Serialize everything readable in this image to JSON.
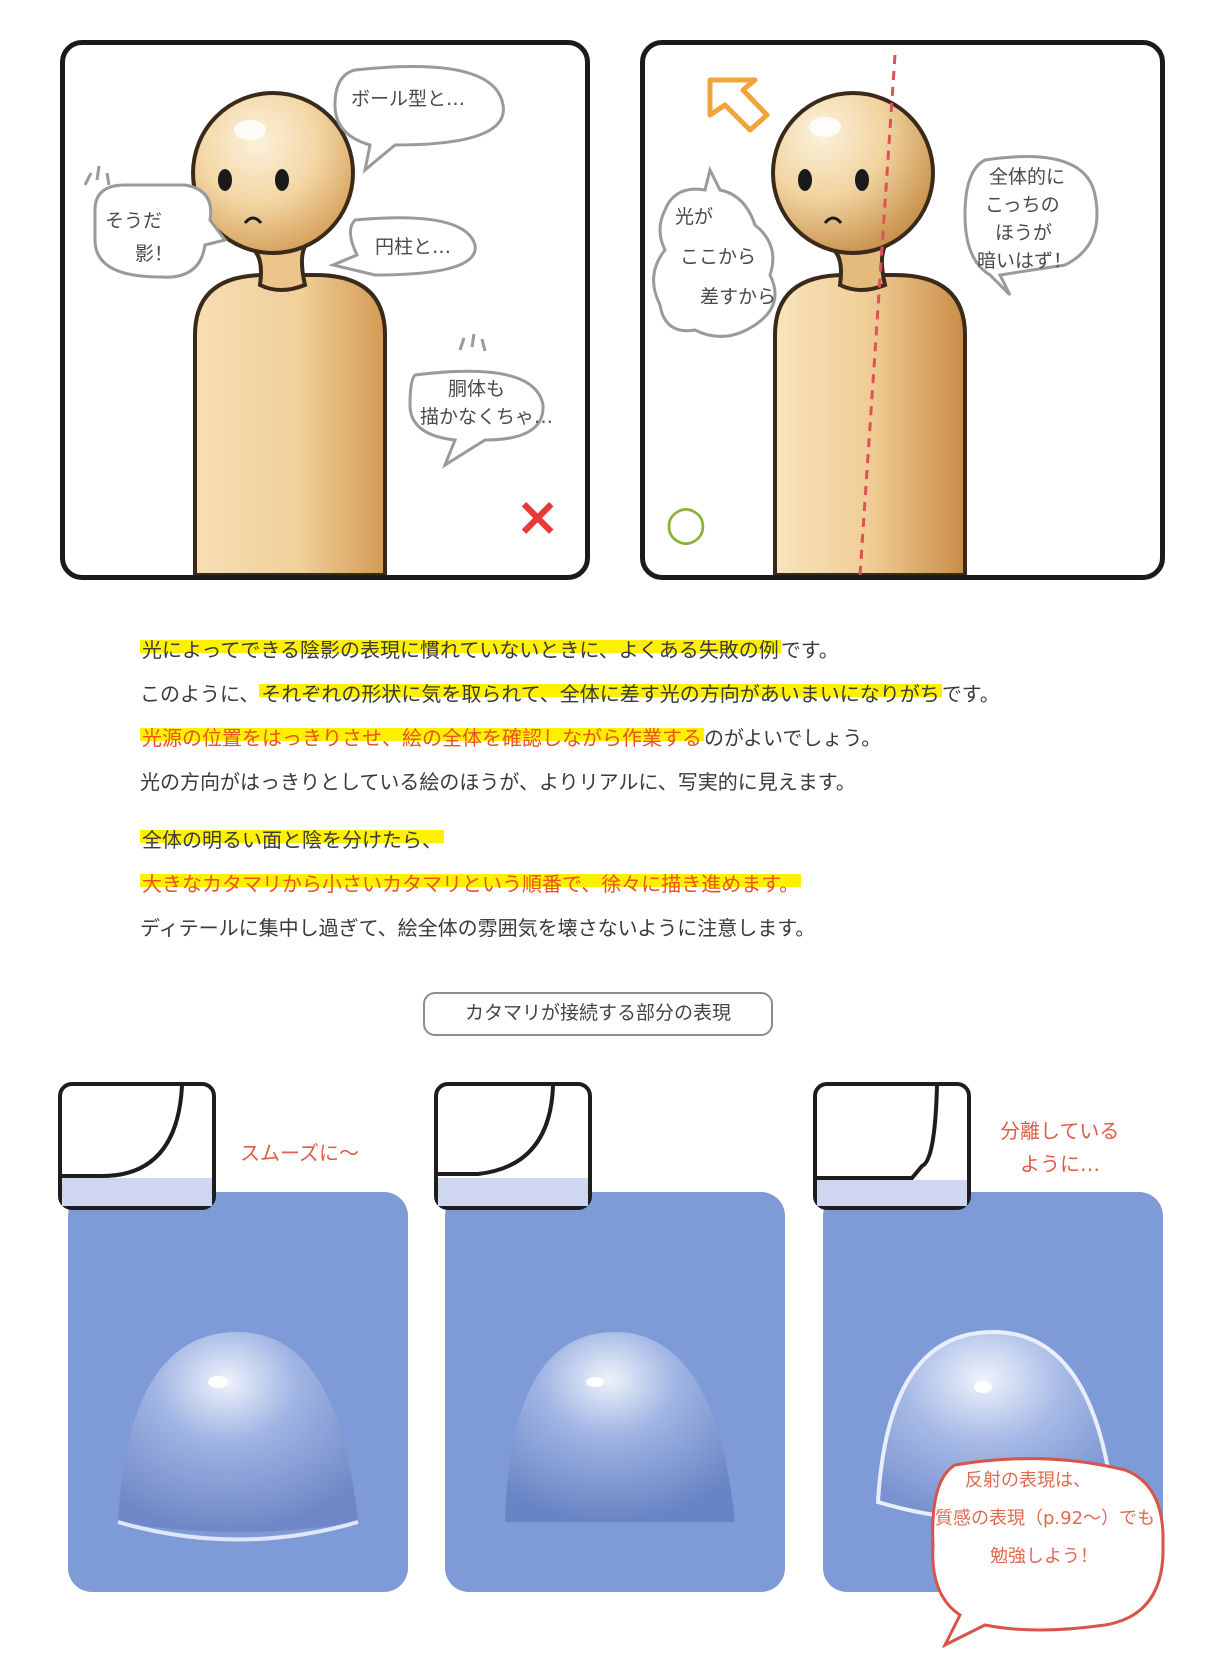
{
  "panel_bad": {
    "bubble_ball": "ボール型と…",
    "bubble_shadow": [
      "そうだ",
      "影！"
    ],
    "bubble_cylinder": "円柱と…",
    "bubble_torso": [
      "胴体も",
      "描かなくちゃ…"
    ],
    "mark": "×"
  },
  "panel_good": {
    "bubble_light": [
      "光が",
      "ここから",
      "差すから"
    ],
    "bubble_dark": [
      "全体的に",
      "こっちの",
      "ほうが",
      "暗いはず！"
    ],
    "mark": "○"
  },
  "body_text": {
    "p1": [
      {
        "hl": "光によってできる陰影の表現に慣れていないときに、よくある失敗の例",
        "rest": "です。"
      },
      {
        "pre": "このように、",
        "hl": "それぞれの形状に気を取られて、全体に差す光の方向があいまいになりがち",
        "rest": "です。"
      },
      {
        "hl_red": "光源の位置をはっきりさせ、絵の全体を確認しながら作業する",
        "rest": "のがよいでしょう。"
      },
      {
        "plain": "光の方向がはっきりとしている絵のほうが、よりリアルに、写実的に見えます。"
      }
    ],
    "p2": [
      {
        "hl": "全体の明るい面と陰を分けたら、"
      },
      {
        "hl_red": "大きなカタマリから小さいカタマリという順番で、徐々に描き進めます。"
      },
      {
        "plain": "ディテールに集中し過ぎて、絵全体の雰囲気を壊さないように注意します。"
      }
    ]
  },
  "section_title": "カタマリが接続する部分の表現",
  "samples": {
    "smooth_caption": "スムーズに～",
    "separate_caption": [
      "分離している",
      "ように…"
    ]
  },
  "note": [
    "反射の表現は、",
    "質感の表現（p.92～）でも",
    "勉強しよう！"
  ],
  "colors": {
    "highlight": "#fff000",
    "accent_red": "#e8531f",
    "sample_blue": "#7f9bd7",
    "skin": "#f3d6a4"
  }
}
